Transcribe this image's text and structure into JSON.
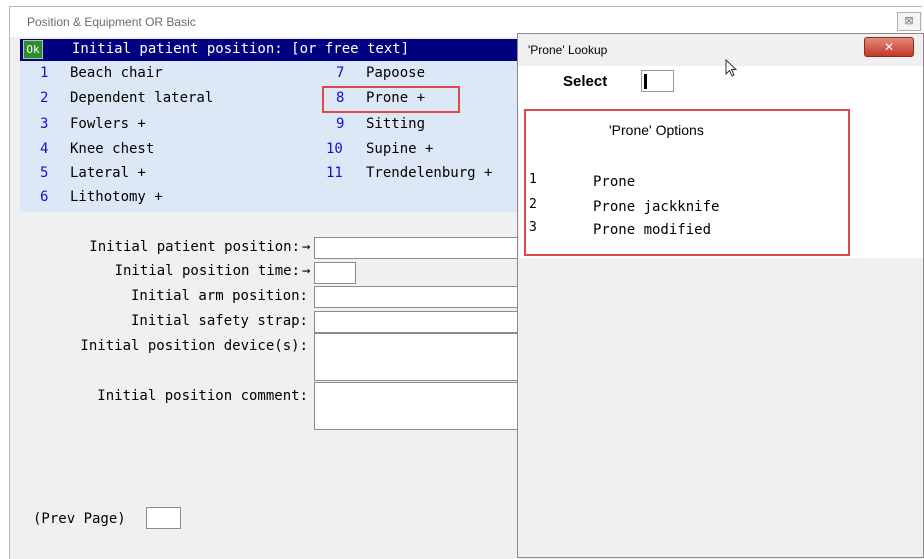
{
  "window": {
    "title": "Position & Equipment OR Basic",
    "close_glyph": "⊠"
  },
  "header": {
    "ok_label": "Ok",
    "prompt": "Initial patient position: [or free text]"
  },
  "choices": [
    {
      "num": "1",
      "label": "Beach chair"
    },
    {
      "num": "2",
      "label": "Dependent lateral"
    },
    {
      "num": "3",
      "label": "Fowlers +"
    },
    {
      "num": "4",
      "label": "Knee chest"
    },
    {
      "num": "5",
      "label": "Lateral +"
    },
    {
      "num": "6",
      "label": "Lithotomy +"
    },
    {
      "num": "7",
      "label": "Papoose"
    },
    {
      "num": "8",
      "label": "Prone +"
    },
    {
      "num": "9",
      "label": "Sitting"
    },
    {
      "num": "10",
      "label": "Supine +"
    },
    {
      "num": "11",
      "label": "Trendelenburg +"
    }
  ],
  "form": {
    "patient_position": "Initial patient position:",
    "position_time": "Initial position time:",
    "arm_position": "Initial arm position:",
    "safety_strap": "Initial safety strap:",
    "position_devices": "Initial position device(s):",
    "position_comment": "Initial position comment:",
    "arrow": "→",
    "prev_page": "(Prev Page)"
  },
  "popup": {
    "title": "'Prone' Lookup",
    "close_glyph": "✕",
    "select_label": "Select",
    "options_title": "'Prone' Options",
    "options": [
      {
        "num": "1",
        "label": "Prone"
      },
      {
        "num": "2",
        "label": "Prone jackknife"
      },
      {
        "num": "3",
        "label": "Prone modified"
      }
    ]
  },
  "colors": {
    "header_bg": "#000080",
    "panel_bg": "#dde8f6",
    "number_blue": "#1010d0",
    "highlight_red": "#d94a4a",
    "ok_green": "#2e8b2e"
  }
}
